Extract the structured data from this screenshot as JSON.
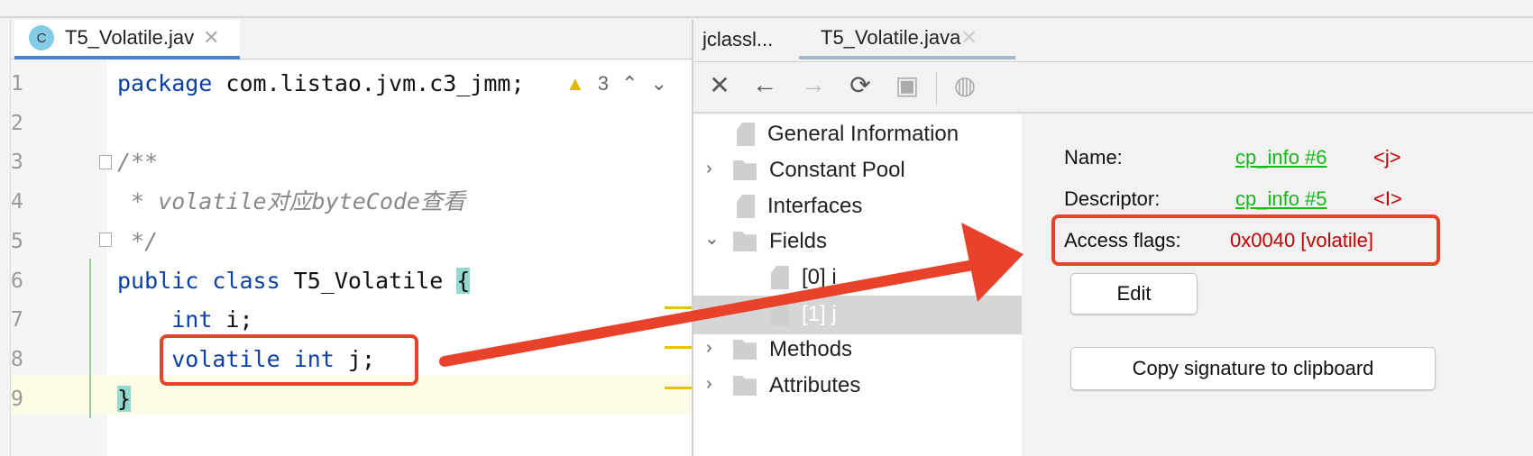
{
  "editor": {
    "tab": {
      "icon": "C",
      "label": "T5_Volatile.jav",
      "close": "✕"
    },
    "inspection": {
      "icon": "warning-icon",
      "count": "3",
      "up": "⌃",
      "down": "⌄"
    },
    "lines": [
      {
        "n": "1"
      },
      {
        "n": "2"
      },
      {
        "n": "3"
      },
      {
        "n": "4"
      },
      {
        "n": "5"
      },
      {
        "n": "6"
      },
      {
        "n": "7"
      },
      {
        "n": "8"
      },
      {
        "n": "9"
      }
    ],
    "code": {
      "l1_kw": "package",
      "l1_rest": " com.listao.jvm.c3_jmm;",
      "l3": "/**",
      "l4": " * volatile对应byteCode查看",
      "l5": " */",
      "l6_kw": "public class",
      "l6_rest": " T5_Volatile ",
      "l6_br": "{",
      "l7_kw": "int",
      "l7_rest": " i;",
      "l8_kw1": "volatile",
      "l8_kw2": "int",
      "l8_rest": " j;",
      "l9_br": "}"
    }
  },
  "viewer": {
    "tabs": [
      "jclassl...",
      "T5_Volatile.java"
    ],
    "tab_close": "✕",
    "toolbar": [
      "close-icon",
      "back-icon",
      "forward-icon",
      "refresh-icon",
      "save-icon",
      "web-icon"
    ],
    "tree": [
      {
        "label": "General Information"
      },
      {
        "label": "Constant Pool"
      },
      {
        "label": "Interfaces"
      },
      {
        "label": "Fields"
      },
      {
        "label": "[0] i"
      },
      {
        "label": "[1] j"
      },
      {
        "label": "Methods"
      },
      {
        "label": "Attributes"
      }
    ],
    "details": {
      "name_label": "Name:",
      "name_link": "cp_info #6",
      "name_value": "<j>",
      "descriptor_label": "Descriptor:",
      "descriptor_link": "cp_info #5",
      "descriptor_value": "<I>",
      "access_label": "Access flags:",
      "access_value": "0x0040 [volatile]",
      "edit": "Edit",
      "copy": "Copy signature to clipboard"
    }
  },
  "colors": {
    "annotation": "#e8432a",
    "link": "#17b817",
    "value": "#c40000",
    "keyword": "#0b3fa6"
  }
}
